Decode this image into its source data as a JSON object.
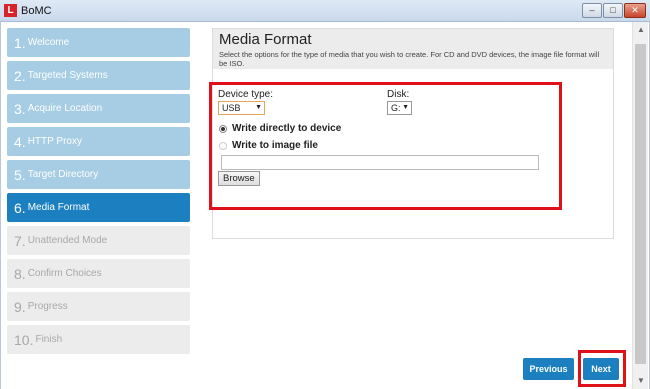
{
  "window": {
    "title": "BoMC",
    "logo_letter": "L",
    "controls": {
      "minimize": "‒",
      "maximize": "□",
      "close": "✕"
    }
  },
  "steps": [
    {
      "num": "1.",
      "label": "Welcome",
      "state": "completed"
    },
    {
      "num": "2.",
      "label": "Targeted Systems",
      "state": "completed"
    },
    {
      "num": "3.",
      "label": "Acquire Location",
      "state": "completed"
    },
    {
      "num": "4.",
      "label": "HTTP Proxy",
      "state": "completed"
    },
    {
      "num": "5.",
      "label": "Target Directory",
      "state": "completed"
    },
    {
      "num": "6.",
      "label": "Media Format",
      "state": "active"
    },
    {
      "num": "7.",
      "label": "Unattended Mode",
      "state": "disabled"
    },
    {
      "num": "8.",
      "label": "Confirm Choices",
      "state": "disabled"
    },
    {
      "num": "9.",
      "label": "Progress",
      "state": "disabled"
    },
    {
      "num": "10.",
      "label": "Finish",
      "state": "disabled"
    }
  ],
  "main": {
    "title": "Media Format",
    "description": "Select the options for the type of media that you wish to create. For CD and DVD devices, the image file format will be ISO.",
    "device_type": {
      "label": "Device type:",
      "value": "USB"
    },
    "disk": {
      "label": "Disk:",
      "value": "G:"
    },
    "options": {
      "write_device": {
        "label": "Write directly to device",
        "checked": true
      },
      "write_image": {
        "label": "Write to image file",
        "checked": false
      }
    },
    "image_path": {
      "value": ""
    },
    "browse_label": "Browse"
  },
  "footer": {
    "previous_label": "Previous",
    "next_label": "Next"
  },
  "colors": {
    "active_step": "#1b7fc0",
    "completed_step": "#a6cde3",
    "disabled_step": "#ececec",
    "highlight": "#e0101a",
    "button": "#1b7fc0"
  }
}
